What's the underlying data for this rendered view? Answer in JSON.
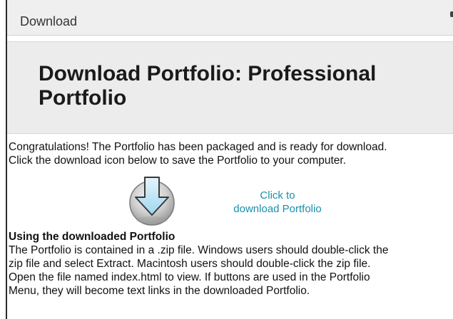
{
  "titlebar": {
    "title": "Download"
  },
  "header": {
    "title": "Download Portfolio: Professional Portfolio"
  },
  "intro": {
    "lines": [
      "Congratulations! The Portfolio has been packaged and is ready for download.",
      "Click the download icon below to save the Portfolio to your computer."
    ]
  },
  "download": {
    "icon": "download-arrow-icon",
    "link_lines": [
      "Click to",
      "download Portfolio"
    ]
  },
  "usage": {
    "heading": "Using the downloaded Portfolio",
    "lines": [
      "The Portfolio is contained in a .zip file. Windows users should double-click the",
      "zip file and select Extract. Macintosh users should double-click the zip file.",
      "Open the file named index.html to view. If buttons are used in the Portfolio",
      "Menu, they will become text links in the downloaded Portfolio."
    ]
  },
  "colors": {
    "link": "#1a8fa8",
    "header_band": "#ececec",
    "titlebar": "#efefef",
    "arrow_fill": "#bfe4f5",
    "arrow_stroke": "#3a3a3a"
  }
}
